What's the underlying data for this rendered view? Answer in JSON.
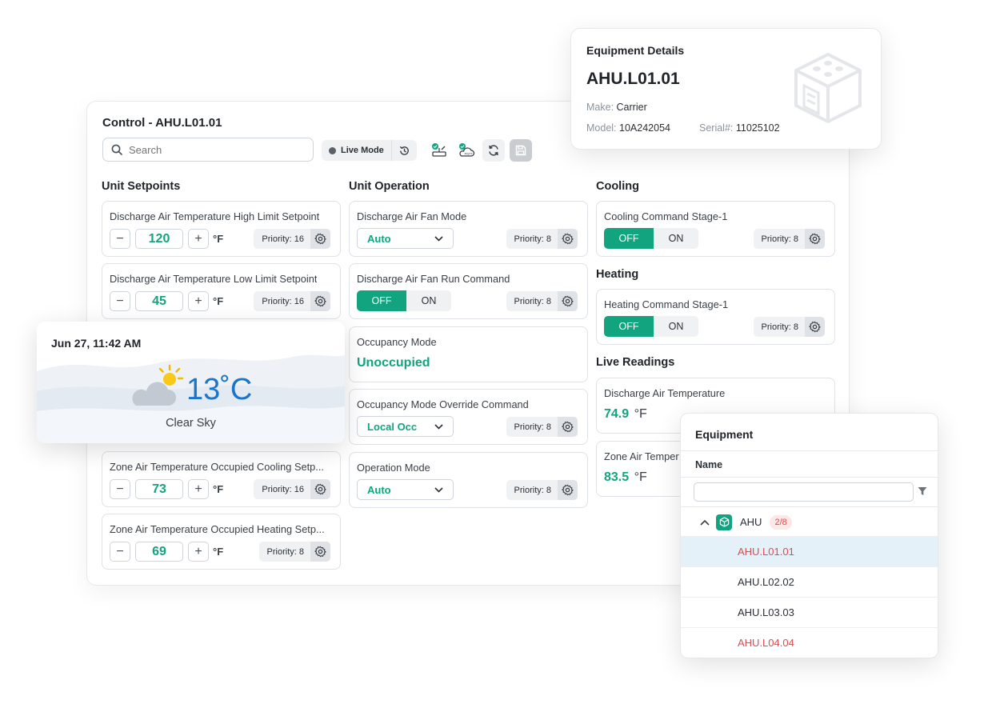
{
  "control": {
    "title": "Control - AHU.L01.01",
    "search_placeholder": "Search",
    "live_mode_label": "Live Mode"
  },
  "sections": {
    "setpoints": "Unit Setpoints",
    "operation": "Unit Operation",
    "cooling": "Cooling",
    "heating": "Heating",
    "live": "Live Readings"
  },
  "setpoints": [
    {
      "label": "Discharge Air Temperature High Limit Setpoint",
      "value": "120",
      "unit": "°F",
      "priority": "Priority: 16"
    },
    {
      "label": "Discharge Air Temperature Low Limit Setpoint",
      "value": "45",
      "unit": "°F",
      "priority": "Priority: 16"
    },
    {
      "label": "Zone Air Temperature Occupied Cooling Setp...",
      "value": "73",
      "unit": "°F",
      "priority": "Priority: 16"
    },
    {
      "label": "Zone Air Temperature Occupied Heating Setp...",
      "value": "69",
      "unit": "°F",
      "priority": "Priority: 8"
    }
  ],
  "operation": {
    "fan_mode": {
      "label": "Discharge Air Fan Mode",
      "value": "Auto",
      "priority": "Priority: 8"
    },
    "fan_run": {
      "label": "Discharge Air Fan Run Command",
      "off": "OFF",
      "on": "ON",
      "priority": "Priority: 8"
    },
    "occupancy": {
      "label": "Occupancy Mode",
      "value": "Unoccupied"
    },
    "occ_override": {
      "label": "Occupancy Mode Override Command",
      "value": "Local Occ",
      "priority": "Priority: 8"
    },
    "op_mode": {
      "label": "Operation Mode",
      "value": "Auto",
      "priority": "Priority: 8"
    }
  },
  "cooling": {
    "label": "Cooling Command Stage-1",
    "off": "OFF",
    "on": "ON",
    "priority": "Priority: 8"
  },
  "heating": {
    "label": "Heating Command Stage-1",
    "off": "OFF",
    "on": "ON",
    "priority": "Priority: 8"
  },
  "readings": [
    {
      "label": "Discharge Air Temperature",
      "value": "74.9",
      "unit": "°F"
    },
    {
      "label": "Zone Air Temper",
      "value": "83.5",
      "unit": "°F"
    }
  ],
  "details": {
    "heading": "Equipment Details",
    "name": "AHU.L01.01",
    "make_label": "Make:",
    "make": "Carrier",
    "model_label": "Model:",
    "model": "10A242054",
    "serial_label": "Serial#:",
    "serial": "11025102"
  },
  "weather": {
    "date": "Jun 27, 11:42 AM",
    "temp": "13˚C",
    "condition": "Clear Sky"
  },
  "equipment": {
    "title": "Equipment",
    "column": "Name",
    "group": "AHU",
    "group_count": "2/8",
    "items": [
      "AHU.L01.01",
      "AHU.L02.02",
      "AHU.L03.03",
      "AHU.L04.04"
    ]
  },
  "colors": {
    "accent": "#12a37f",
    "alert": "#e5484d",
    "weather": "#1b75c9"
  }
}
